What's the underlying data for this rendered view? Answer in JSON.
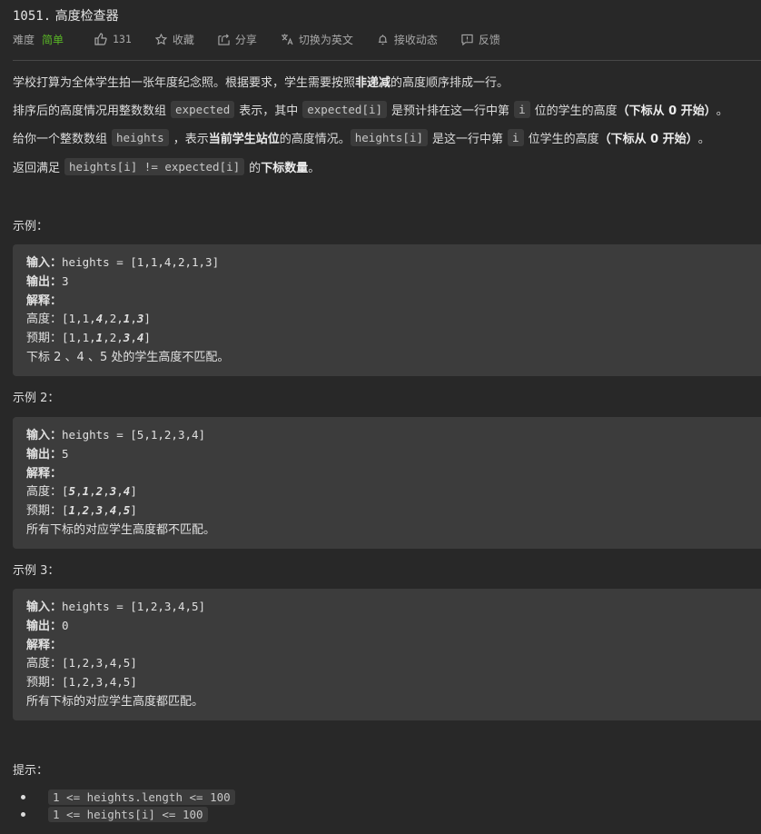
{
  "problem": {
    "number": "1051.",
    "title": "高度检查器"
  },
  "meta": {
    "difficulty_label": "难度",
    "difficulty_value": "简单",
    "difficulty_color": "#5ab726",
    "likes": "131",
    "favorite": "收藏",
    "share": "分享",
    "switch_lang": "切换为英文",
    "subscribe": "接收动态",
    "feedback": "反馈"
  },
  "description": {
    "p1": {
      "a": "学校打算为全体学生拍一张年度纪念照。根据要求，学生需要按照 ",
      "b": "非递减",
      "c": " 的高度顺序排成一行。"
    },
    "p2": {
      "a": "排序后的高度情况用整数数组",
      "code1": "expected",
      "b": "表示，其中",
      "code2": "expected[i]",
      "c": "是预计排在这一行中第",
      "code3": "i",
      "d": "位的学生的高度",
      "e": "（下标从 0 开始）",
      "f": "。"
    },
    "p3": {
      "a": "给你一个整数数组",
      "code1": "heights",
      "b": "，表示 ",
      "c": "当前学生站位",
      "d": " 的高度情况。",
      "code2": "heights[i]",
      "e": "是这一行中第",
      "code3": "i",
      "f": "位学生的高度",
      "g": "（下标从 0 开始）",
      "h": "。"
    },
    "p4": {
      "a": "返回满足",
      "code1": "heights[i] != expected[i]",
      "b": "的 ",
      "c": "下标数量",
      "d": " 。"
    }
  },
  "examples": [
    {
      "title": "示例：",
      "input_label": "输入：",
      "input": "heights = [1,1,4,2,1,3]",
      "output_label": "输出：",
      "output": "3",
      "explain_label": "解释：",
      "heights_label": "高度：",
      "heights": [
        {
          "v": "1",
          "em": false
        },
        {
          "v": "1",
          "em": false
        },
        {
          "v": "4",
          "em": true
        },
        {
          "v": "2",
          "em": false
        },
        {
          "v": "1",
          "em": true
        },
        {
          "v": "3",
          "em": true
        }
      ],
      "expected_label": "预期：",
      "expected": [
        {
          "v": "1",
          "em": false
        },
        {
          "v": "1",
          "em": false
        },
        {
          "v": "1",
          "em": true
        },
        {
          "v": "2",
          "em": false
        },
        {
          "v": "3",
          "em": true
        },
        {
          "v": "4",
          "em": true
        }
      ],
      "note": "下标 2 、4 、5 处的学生高度不匹配。"
    },
    {
      "title": "示例 2：",
      "input_label": "输入：",
      "input": "heights = [5,1,2,3,4]",
      "output_label": "输出：",
      "output": "5",
      "explain_label": "解释：",
      "heights_label": "高度：",
      "heights": [
        {
          "v": "5",
          "em": true
        },
        {
          "v": "1",
          "em": true
        },
        {
          "v": "2",
          "em": true
        },
        {
          "v": "3",
          "em": true
        },
        {
          "v": "4",
          "em": true
        }
      ],
      "expected_label": "预期：",
      "expected": [
        {
          "v": "1",
          "em": true
        },
        {
          "v": "2",
          "em": true
        },
        {
          "v": "3",
          "em": true
        },
        {
          "v": "4",
          "em": true
        },
        {
          "v": "5",
          "em": true
        }
      ],
      "note": "所有下标的对应学生高度都不匹配。"
    },
    {
      "title": "示例 3：",
      "input_label": "输入：",
      "input": "heights = [1,2,3,4,5]",
      "output_label": "输出：",
      "output": "0",
      "explain_label": "解释：",
      "heights_label": "高度：",
      "heights": [
        {
          "v": "1",
          "em": false
        },
        {
          "v": "2",
          "em": false
        },
        {
          "v": "3",
          "em": false
        },
        {
          "v": "4",
          "em": false
        },
        {
          "v": "5",
          "em": false
        }
      ],
      "expected_label": "预期：",
      "expected": [
        {
          "v": "1",
          "em": false
        },
        {
          "v": "2",
          "em": false
        },
        {
          "v": "3",
          "em": false
        },
        {
          "v": "4",
          "em": false
        },
        {
          "v": "5",
          "em": false
        }
      ],
      "note": "所有下标的对应学生高度都匹配。"
    }
  ],
  "tips": {
    "title": "提示：",
    "items": [
      "1 <= heights.length <= 100",
      "1 <= heights[i] <= 100"
    ]
  }
}
